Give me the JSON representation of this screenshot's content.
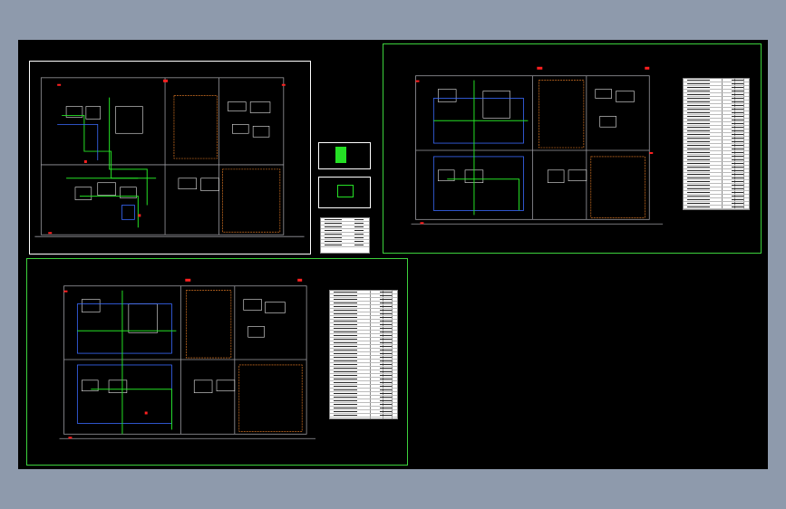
{
  "viewer": {
    "background_color": "#8e9aac",
    "canvas_color": "#000000"
  },
  "sheets": [
    {
      "id": "sheet-1",
      "frame_color": "#ffffff",
      "title": "",
      "selected": false
    },
    {
      "id": "sheet-2",
      "frame_color": "#3cd23c",
      "title": "",
      "selected": true
    },
    {
      "id": "sheet-3",
      "frame_color": "#3cd23c",
      "title": "",
      "selected": true
    }
  ],
  "colors": {
    "road": "#9a9aa0",
    "building": "#e8e8e8",
    "pipe_green": "#25e025",
    "pipe_blue": "#3b6bff",
    "mark_red": "#ff2020",
    "boundary_orange": "#ff8a2a",
    "note_blue": "#2a6aff"
  },
  "legend_tables": {
    "sheet_2_table_rows": 40,
    "sheet_3_table_rows": 40,
    "sheet_1_small_table_rows": 8
  }
}
